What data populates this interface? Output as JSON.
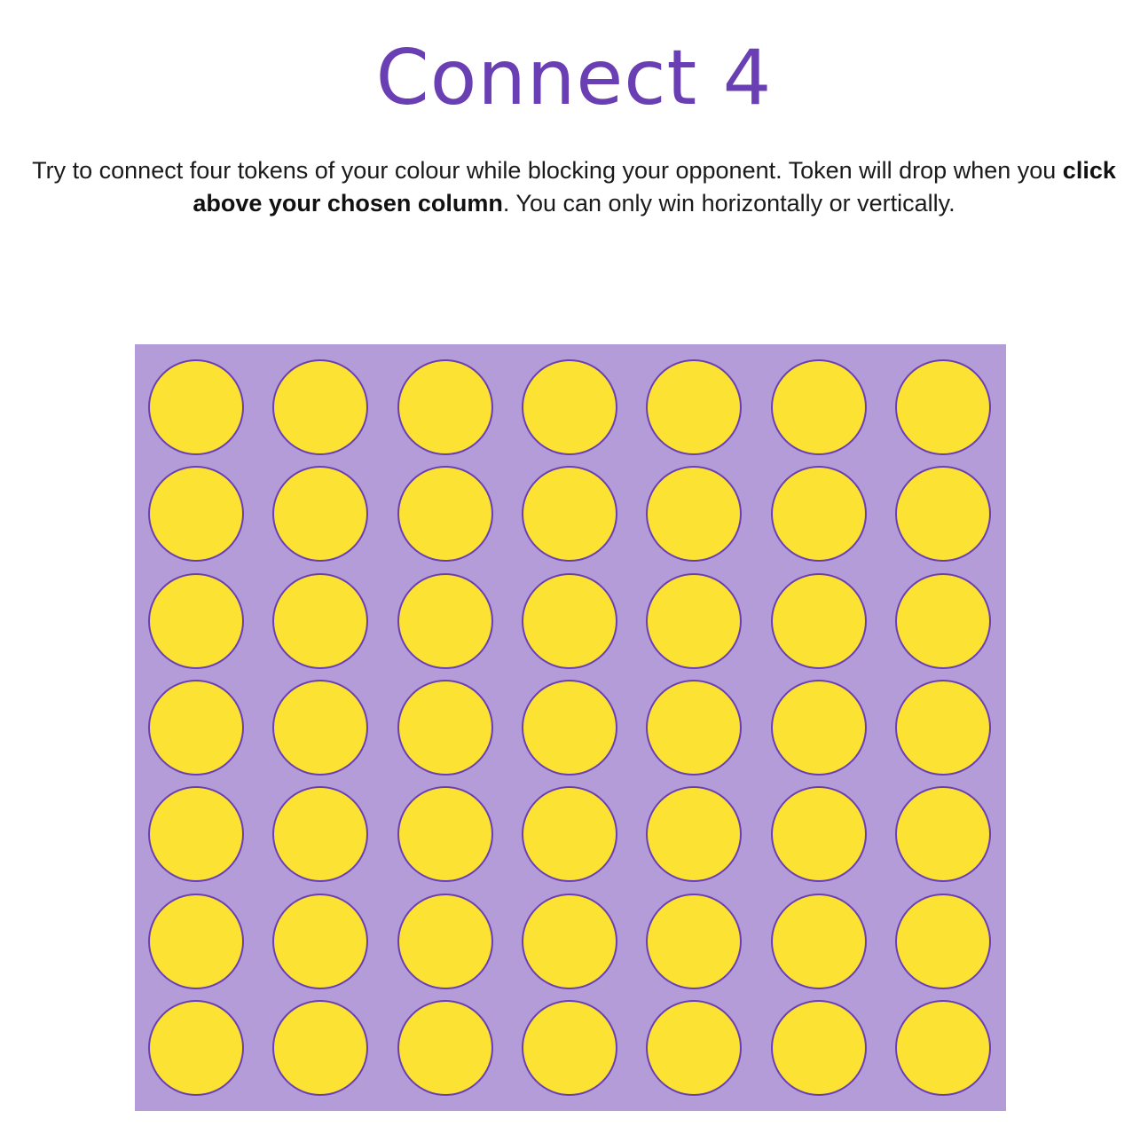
{
  "header": {
    "title": "Connect 4"
  },
  "instructions": {
    "part1": "Try to connect four tokens of your colour while blocking your opponent. Token will drop when you ",
    "emphasis": "click above your chosen column",
    "part2": ". You can only win horizontally or vertically."
  },
  "board": {
    "columns": 7,
    "rows": 7,
    "slot_color": "#fce233",
    "slot_border_color": "#6a3fb3",
    "board_color": "#b39cd8",
    "cells": [
      [
        "empty",
        "empty",
        "empty",
        "empty",
        "empty",
        "empty",
        "empty"
      ],
      [
        "empty",
        "empty",
        "empty",
        "empty",
        "empty",
        "empty",
        "empty"
      ],
      [
        "empty",
        "empty",
        "empty",
        "empty",
        "empty",
        "empty",
        "empty"
      ],
      [
        "empty",
        "empty",
        "empty",
        "empty",
        "empty",
        "empty",
        "empty"
      ],
      [
        "empty",
        "empty",
        "empty",
        "empty",
        "empty",
        "empty",
        "empty"
      ],
      [
        "empty",
        "empty",
        "empty",
        "empty",
        "empty",
        "empty",
        "empty"
      ],
      [
        "empty",
        "empty",
        "empty",
        "empty",
        "empty",
        "empty",
        "empty"
      ]
    ]
  },
  "colors": {
    "accent": "#6a3fb3",
    "text": "#1a1a1a"
  }
}
